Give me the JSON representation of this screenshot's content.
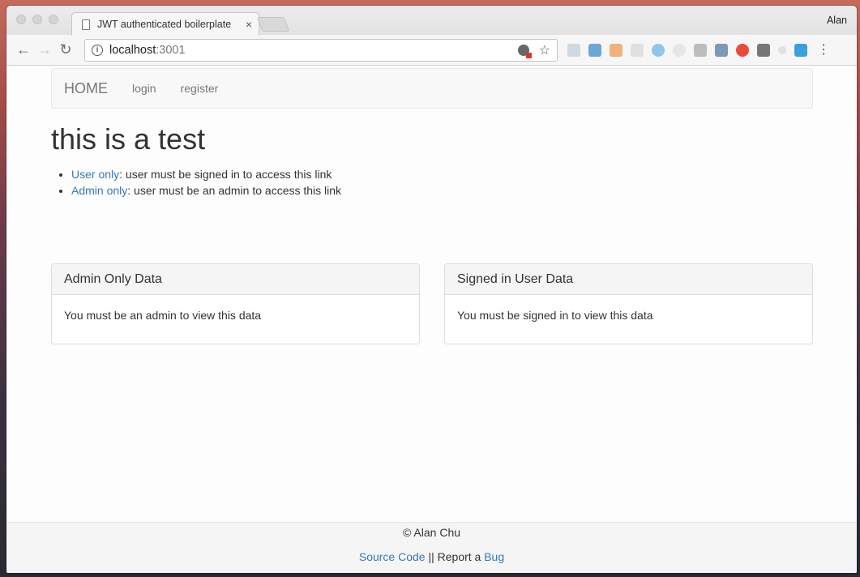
{
  "browser": {
    "tab_title": "JWT authenticated boilerplate",
    "tab_close": "×",
    "profile_name": "Alan",
    "url_host": "localhost",
    "url_port": ":3001",
    "back_glyph": "←",
    "forward_glyph": "→",
    "reload_glyph": "↻",
    "star_glyph": "☆",
    "menu_glyph": "⋮",
    "extension_icons": [
      "skype-icon",
      "eyedropper-icon",
      "bookmark-icon",
      "grid-icon",
      "timer-icon",
      "circle-icon",
      "trash-icon",
      "branch-icon",
      "opera-icon",
      "pocket-icon",
      "dot-icon",
      "s-icon"
    ]
  },
  "navbar": {
    "brand": "HOME",
    "links": [
      "login",
      "register"
    ]
  },
  "main": {
    "heading": "this is a test",
    "list": [
      {
        "link": "User only",
        "text": ": user must be signed in to access this link"
      },
      {
        "link": "Admin only",
        "text": ": user must be an admin to access this link"
      }
    ],
    "panels": [
      {
        "title": "Admin Only Data",
        "body": "You must be an admin to view this data"
      },
      {
        "title": "Signed in User Data",
        "body": "You must be signed in to view this data"
      }
    ]
  },
  "footer": {
    "copyright": "© Alan Chu",
    "source_link": "Source Code",
    "separator": " || Report a ",
    "bug_link": "Bug"
  },
  "colors": {
    "link": "#337ab7",
    "navbar_bg": "#f8f8f8",
    "panel_heading_bg": "#f5f5f5"
  }
}
